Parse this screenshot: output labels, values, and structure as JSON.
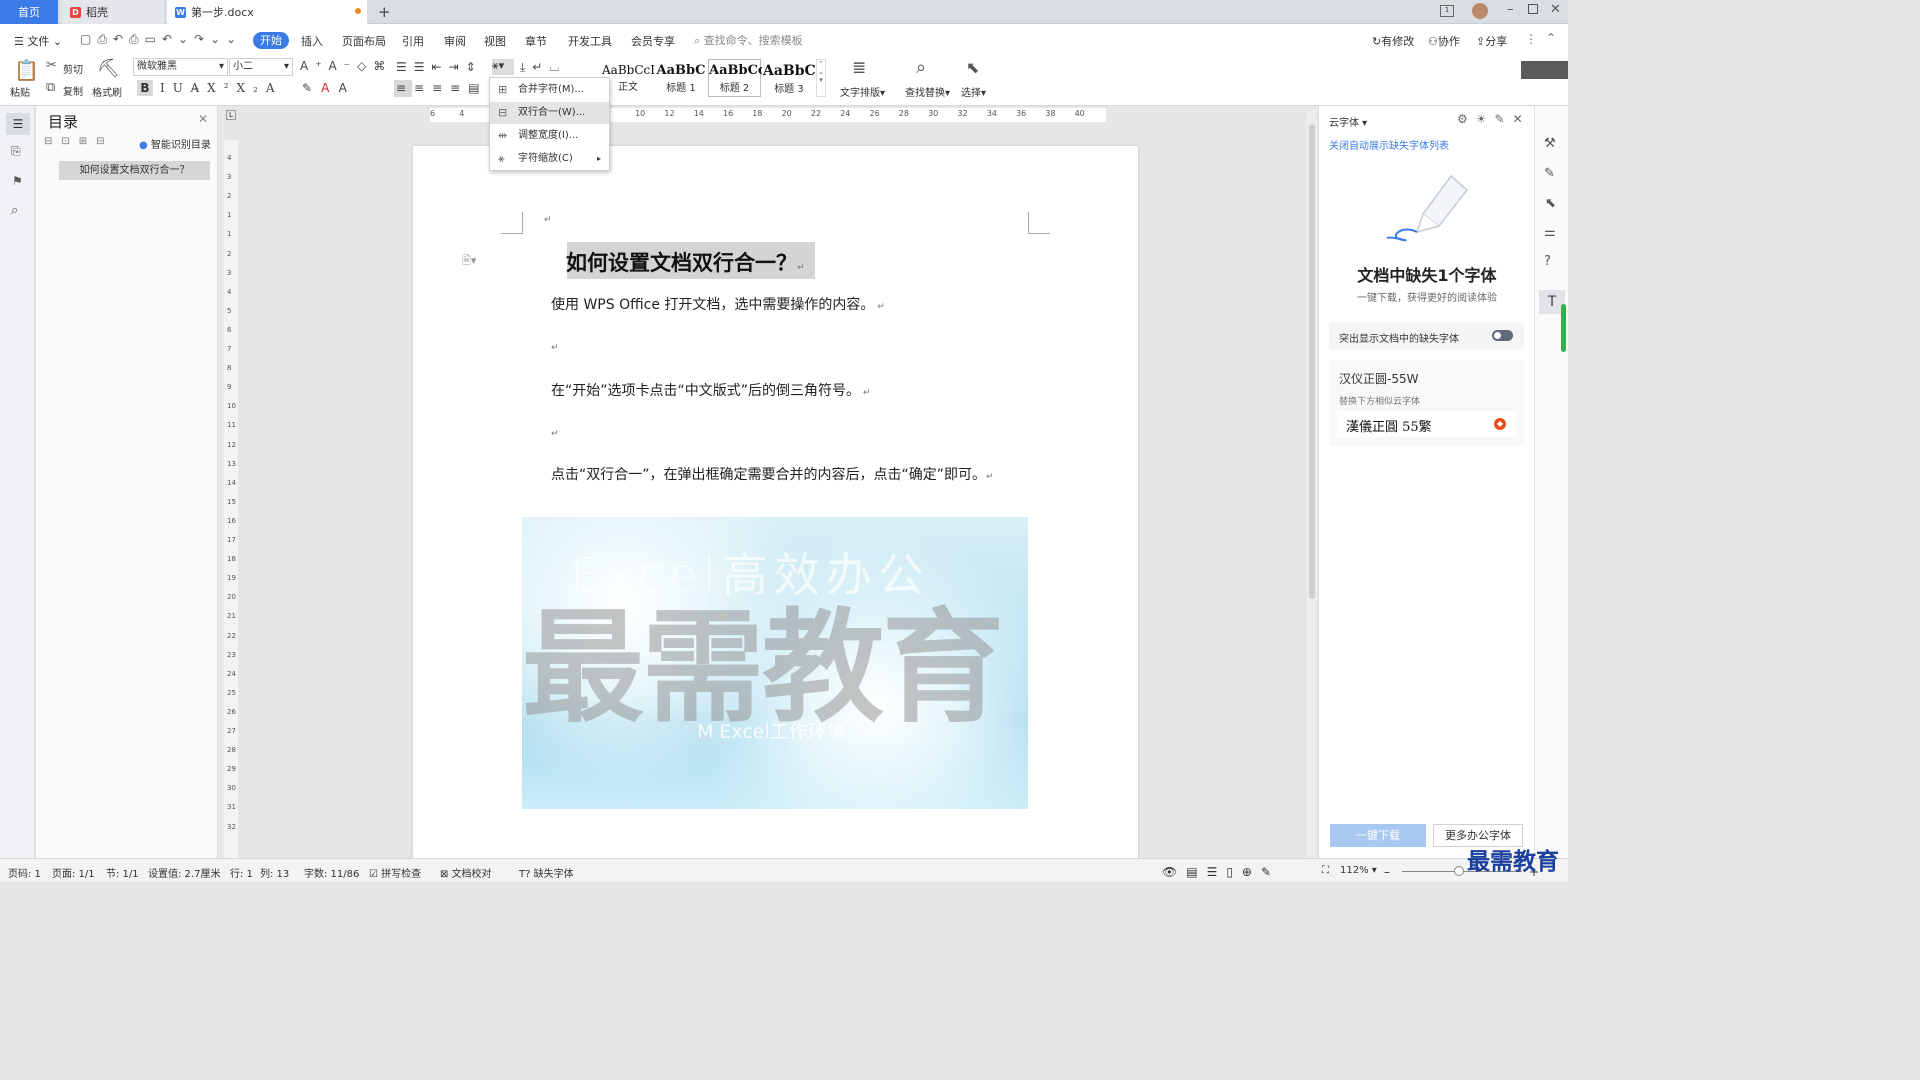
{
  "tabs": {
    "home": "首页",
    "daoke": "稻壳",
    "doc": "第一步.docx"
  },
  "menu": {
    "file": "文件",
    "start": "开始",
    "items": [
      "插入",
      "页面布局",
      "引用",
      "审阅",
      "视图",
      "章节",
      "开发工具",
      "会员专享"
    ],
    "search_placeholder": "查找命令、搜索模板",
    "right": [
      "有修改",
      "协作",
      "分享"
    ]
  },
  "ribbon": {
    "paste": "粘贴",
    "cut": "剪切",
    "copy": "复制",
    "format_painter": "格式刷",
    "font_name": "微软雅黑",
    "font_size": "小二",
    "styles": [
      {
        "sample": "AaBbCcI",
        "name": "正文"
      },
      {
        "sample": "AaBbC",
        "name": "标题 1"
      },
      {
        "sample": "AaBbCc",
        "name": "标题 2"
      },
      {
        "sample": "AaBbC",
        "name": "标题 3"
      }
    ],
    "text_layout": "文字排版",
    "find_replace": "查找替换",
    "select": "选择"
  },
  "dropdown": {
    "items": [
      "合并字符(M)...",
      "双行合一(W)...",
      "调整宽度(I)...",
      "字符缩放(C)"
    ]
  },
  "toc": {
    "title": "目录",
    "smart": "智能识别目录",
    "entry": "如何设置文档双行合一？"
  },
  "ruler": {
    "h_ticks": [
      "6",
      "4",
      "2",
      "2",
      "4",
      "6",
      "8",
      "10",
      "12",
      "14",
      "16",
      "18",
      "20",
      "22",
      "24",
      "26",
      "28",
      "30",
      "32",
      "34",
      "36",
      "38",
      "40"
    ],
    "v_ticks": [
      "4",
      "3",
      "2",
      "1",
      "1",
      "2",
      "3",
      "4",
      "5",
      "6",
      "7",
      "8",
      "9",
      "10",
      "11",
      "12",
      "13",
      "14",
      "15",
      "16",
      "17",
      "18",
      "19",
      "20",
      "21",
      "22",
      "23",
      "24",
      "25",
      "26",
      "27",
      "28",
      "29",
      "30",
      "31",
      "32"
    ]
  },
  "document": {
    "title": "如何设置文档双行合一？",
    "p1": "使用 WPS Office 打开文档，选中需要操作的内容。",
    "p2": "在“开始”选项卡点击“中文版式”后的倒三角符号。",
    "p3": "点击“双行合一”，在弹出框确定需要合并的内容后，点击“确定”即可。",
    "image_big_text": "最需教育",
    "image_top_text": "Excel高效办公",
    "image_bottom_text": "M Excel工作环境"
  },
  "right_panel": {
    "header": "云字体",
    "close_link": "关闭自动展示缺失字体列表",
    "heading": "文档中缺失1个字体",
    "sub": "一键下载，获得更好的阅读体验",
    "toggle_label": "突出显示文档中的缺失字体",
    "font_missing": "汉仪正圆-55W",
    "replace_hint": "替换下方相似云字体",
    "font_replacement": "漢儀正圓 55繁",
    "download_btn": "一键下载",
    "more_btn": "更多办公字体"
  },
  "status": {
    "page_code": "页码: 1",
    "page": "页面: 1/1",
    "section": "节: 1/1",
    "setting": "设置值: 2.7厘米",
    "row": "行: 1",
    "col": "列: 13",
    "words": "字数: 11/86",
    "spell": "拼写检查",
    "proof": "文档校对",
    "missing_font": "缺失字体",
    "zoom": "112%"
  },
  "watermark": "最需教育",
  "colors": {
    "accent": "#3b7be8",
    "selection": "#d4d4d4",
    "toggle_off": "#5f6b7a"
  }
}
